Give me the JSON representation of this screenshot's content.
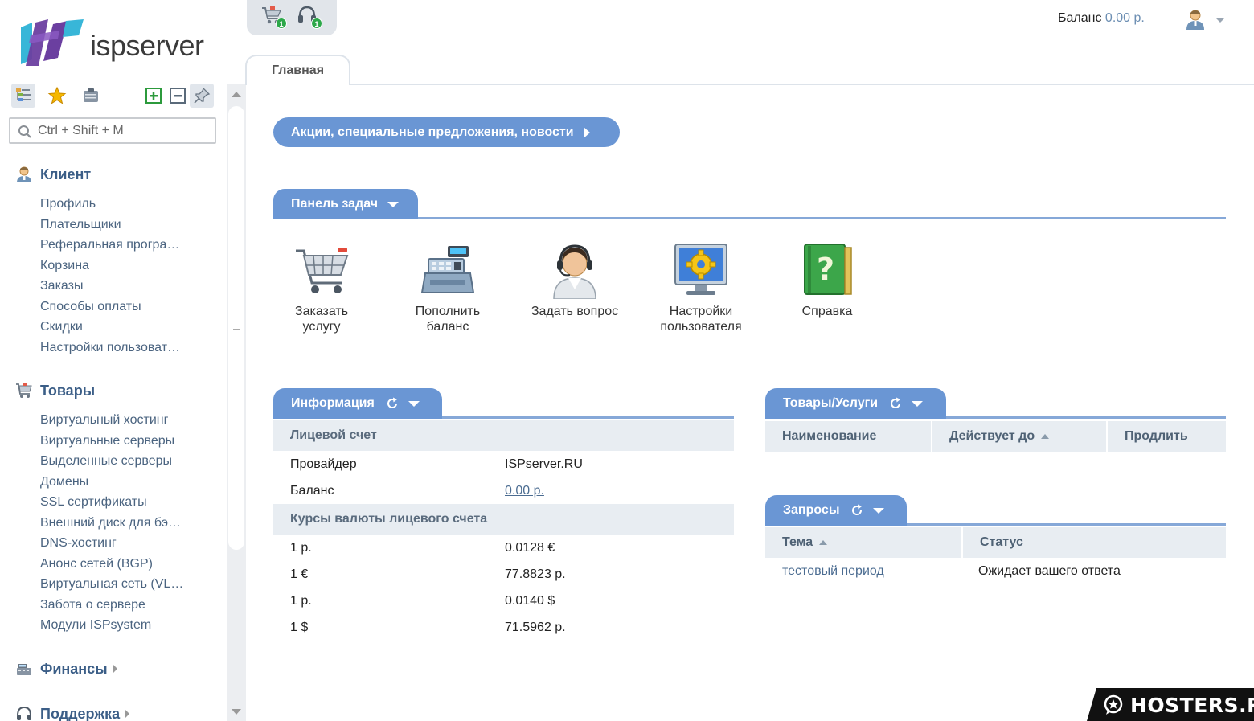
{
  "logo": {
    "text": "ispserver"
  },
  "sidebar": {
    "search_placeholder": "Ctrl + Shift + M",
    "groups": [
      {
        "title": "Клиент",
        "icon": "user-icon",
        "items": [
          "Профиль",
          "Плательщики",
          "Реферальная програ…",
          "Корзина",
          "Заказы",
          "Способы оплаты",
          "Скидки",
          "Настройки пользоват…"
        ]
      },
      {
        "title": "Товары",
        "icon": "cart-icon",
        "items": [
          "Виртуальный хостинг",
          "Виртуальные серверы",
          "Выделенные серверы",
          "Домены",
          "SSL сертификаты",
          "Внешний диск для бэ…",
          "DNS-хостинг",
          "Анонс сетей (BGP)",
          "Виртуальная сеть (VL…",
          "Забота о сервере",
          "Модули ISPsystem"
        ]
      },
      {
        "title": "Финансы",
        "icon": "cash-register-icon"
      },
      {
        "title": "Поддержка",
        "icon": "headset-icon"
      }
    ]
  },
  "top": {
    "cart_badge": "1",
    "support_badge": "1",
    "balance_label": "Баланс",
    "balance_value": "0.00 р."
  },
  "tabs": {
    "main": "Главная"
  },
  "news_button": "Акции, специальные предложения, новости",
  "tasks": {
    "title": "Панель задач",
    "items": [
      {
        "label": "Заказать услугу",
        "icon": "shopping-cart-icon"
      },
      {
        "label": "Пополнить баланс",
        "icon": "cash-register-icon"
      },
      {
        "label": "Задать вопрос",
        "icon": "support-operator-icon"
      },
      {
        "label": "Настройки пользователя",
        "icon": "monitor-gear-icon"
      },
      {
        "label": "Справка",
        "icon": "help-book-icon"
      }
    ]
  },
  "info": {
    "title": "Информация",
    "account_band": "Лицевой счет",
    "provider_label": "Провайдер",
    "provider_value": "ISPserver.RU",
    "balance_label": "Баланс",
    "balance_value": "0.00 р.",
    "rates_band": "Курсы валюты лицевого счета",
    "rates": [
      {
        "from": "1 р.",
        "to": "0.0128 €"
      },
      {
        "from": "1 €",
        "to": "77.8823 р."
      },
      {
        "from": "1 р.",
        "to": "0.0140 $"
      },
      {
        "from": "1 $",
        "to": "71.5962 р."
      }
    ]
  },
  "services": {
    "title": "Товары/Услуги",
    "columns": [
      "Наименование",
      "Действует до",
      "Продлить"
    ]
  },
  "requests": {
    "title": "Запросы",
    "columns": [
      "Тема",
      "Статус"
    ],
    "rows": [
      {
        "topic": "тестовый период",
        "status": "Ожидает вашего ответа"
      }
    ]
  },
  "watermark": "HOSTERS.RU",
  "colors": {
    "accent": "#6a96d4",
    "menu_text": "#4b6480",
    "group_title": "#3b5e87"
  }
}
